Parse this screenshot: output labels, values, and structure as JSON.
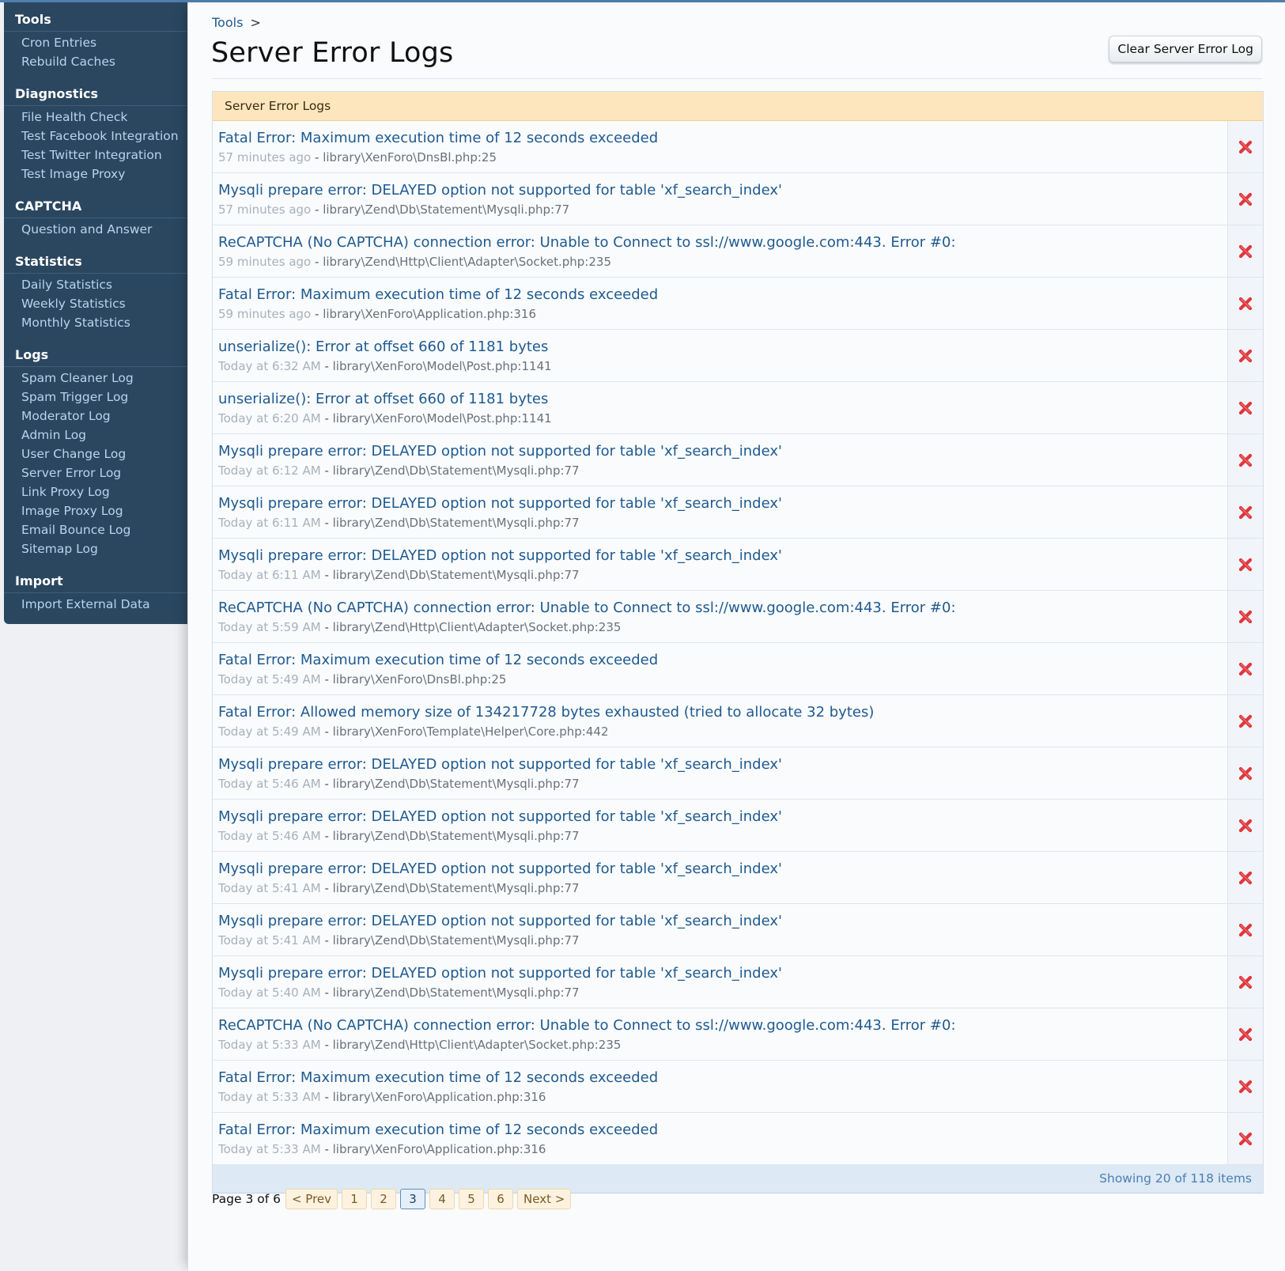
{
  "sidebar": {
    "sections": [
      {
        "heading": "Tools",
        "items": [
          "Cron Entries",
          "Rebuild Caches"
        ]
      },
      {
        "heading": "Diagnostics",
        "items": [
          "File Health Check",
          "Test Facebook Integration",
          "Test Twitter Integration",
          "Test Image Proxy"
        ]
      },
      {
        "heading": "CAPTCHA",
        "items": [
          "Question and Answer"
        ]
      },
      {
        "heading": "Statistics",
        "items": [
          "Daily Statistics",
          "Weekly Statistics",
          "Monthly Statistics"
        ]
      },
      {
        "heading": "Logs",
        "items": [
          "Spam Cleaner Log",
          "Spam Trigger Log",
          "Moderator Log",
          "Admin Log",
          "User Change Log",
          "Server Error Log",
          "Link Proxy Log",
          "Image Proxy Log",
          "Email Bounce Log",
          "Sitemap Log"
        ]
      },
      {
        "heading": "Import",
        "items": [
          "Import External Data"
        ]
      }
    ]
  },
  "breadcrumb": {
    "crumb": "Tools",
    "separator": ">"
  },
  "page": {
    "title": "Server Error Logs",
    "clear_button": "Clear Server Error Log"
  },
  "list": {
    "header": "Server Error Logs",
    "footer": "Showing 20 of 118 items",
    "rows": [
      {
        "title": "Fatal Error: Maximum execution time of 12 seconds exceeded",
        "time": "57 minutes ago",
        "file": "library\\XenForo\\DnsBl.php:25"
      },
      {
        "title": "Mysqli prepare error: DELAYED option not supported for table 'xf_search_index'",
        "time": "57 minutes ago",
        "file": "library\\Zend\\Db\\Statement\\Mysqli.php:77"
      },
      {
        "title": "ReCAPTCHA (No CAPTCHA) connection error: Unable to Connect to ssl://www.google.com:443. Error #0:",
        "time": "59 minutes ago",
        "file": "library\\Zend\\Http\\Client\\Adapter\\Socket.php:235"
      },
      {
        "title": "Fatal Error: Maximum execution time of 12 seconds exceeded",
        "time": "59 minutes ago",
        "file": "library\\XenForo\\Application.php:316"
      },
      {
        "title": "unserialize(): Error at offset 660 of 1181 bytes",
        "time": "Today at 6:32 AM",
        "file": "library\\XenForo\\Model\\Post.php:1141"
      },
      {
        "title": "unserialize(): Error at offset 660 of 1181 bytes",
        "time": "Today at 6:20 AM",
        "file": "library\\XenForo\\Model\\Post.php:1141"
      },
      {
        "title": "Mysqli prepare error: DELAYED option not supported for table 'xf_search_index'",
        "time": "Today at 6:12 AM",
        "file": "library\\Zend\\Db\\Statement\\Mysqli.php:77"
      },
      {
        "title": "Mysqli prepare error: DELAYED option not supported for table 'xf_search_index'",
        "time": "Today at 6:11 AM",
        "file": "library\\Zend\\Db\\Statement\\Mysqli.php:77"
      },
      {
        "title": "Mysqli prepare error: DELAYED option not supported for table 'xf_search_index'",
        "time": "Today at 6:11 AM",
        "file": "library\\Zend\\Db\\Statement\\Mysqli.php:77"
      },
      {
        "title": "ReCAPTCHA (No CAPTCHA) connection error: Unable to Connect to ssl://www.google.com:443. Error #0:",
        "time": "Today at 5:59 AM",
        "file": "library\\Zend\\Http\\Client\\Adapter\\Socket.php:235"
      },
      {
        "title": "Fatal Error: Maximum execution time of 12 seconds exceeded",
        "time": "Today at 5:49 AM",
        "file": "library\\XenForo\\DnsBl.php:25"
      },
      {
        "title": "Fatal Error: Allowed memory size of 134217728 bytes exhausted (tried to allocate 32 bytes)",
        "time": "Today at 5:49 AM",
        "file": "library\\XenForo\\Template\\Helper\\Core.php:442"
      },
      {
        "title": "Mysqli prepare error: DELAYED option not supported for table 'xf_search_index'",
        "time": "Today at 5:46 AM",
        "file": "library\\Zend\\Db\\Statement\\Mysqli.php:77"
      },
      {
        "title": "Mysqli prepare error: DELAYED option not supported for table 'xf_search_index'",
        "time": "Today at 5:46 AM",
        "file": "library\\Zend\\Db\\Statement\\Mysqli.php:77"
      },
      {
        "title": "Mysqli prepare error: DELAYED option not supported for table 'xf_search_index'",
        "time": "Today at 5:41 AM",
        "file": "library\\Zend\\Db\\Statement\\Mysqli.php:77"
      },
      {
        "title": "Mysqli prepare error: DELAYED option not supported for table 'xf_search_index'",
        "time": "Today at 5:41 AM",
        "file": "library\\Zend\\Db\\Statement\\Mysqli.php:77"
      },
      {
        "title": "Mysqli prepare error: DELAYED option not supported for table 'xf_search_index'",
        "time": "Today at 5:40 AM",
        "file": "library\\Zend\\Db\\Statement\\Mysqli.php:77"
      },
      {
        "title": "ReCAPTCHA (No CAPTCHA) connection error: Unable to Connect to ssl://www.google.com:443. Error #0:",
        "time": "Today at 5:33 AM",
        "file": "library\\Zend\\Http\\Client\\Adapter\\Socket.php:235"
      },
      {
        "title": "Fatal Error: Maximum execution time of 12 seconds exceeded",
        "time": "Today at 5:33 AM",
        "file": "library\\XenForo\\Application.php:316"
      },
      {
        "title": "Fatal Error: Maximum execution time of 12 seconds exceeded",
        "time": "Today at 5:33 AM",
        "file": "library\\XenForo\\Application.php:316"
      }
    ],
    "meta_separator": "-",
    "delete_icon": "delete-x-icon"
  },
  "pagination": {
    "label": "Page 3 of 6",
    "prev": "< Prev",
    "next": "Next >",
    "pages": [
      "1",
      "2",
      "3",
      "4",
      "5",
      "6"
    ],
    "current": "3"
  },
  "colors": {
    "sidebar_bg": "#2b4760",
    "link": "#1f5a8f",
    "header_bg": "#fde6bd",
    "delete_red": "#e0363c"
  }
}
